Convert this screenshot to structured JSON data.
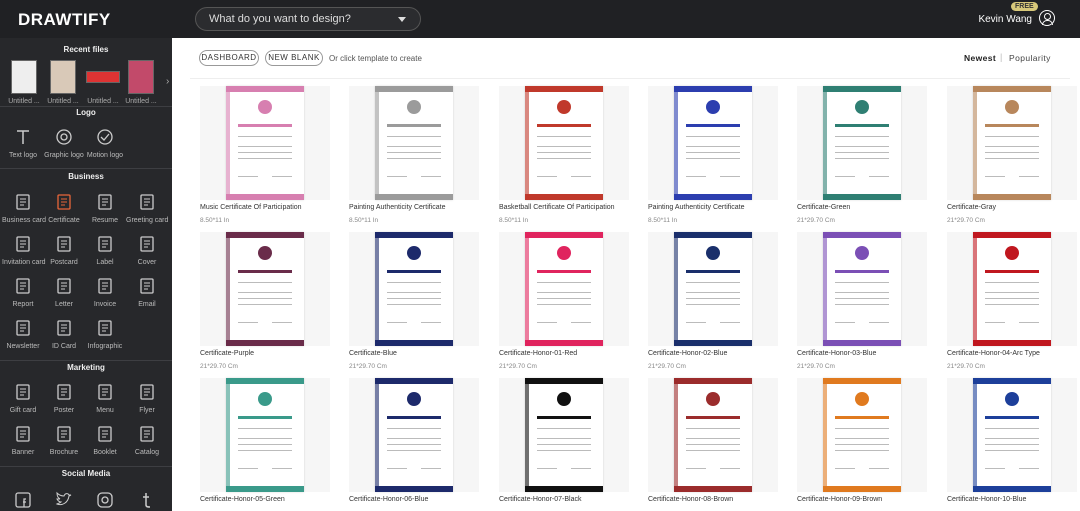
{
  "header": {
    "logo": "DRAWTIFY",
    "search_placeholder": "What do you want to design?",
    "user_name": "Kevin Wang",
    "badge": "FREE"
  },
  "sidebar": {
    "recent_title": "Recent files",
    "recent": [
      "Untitled ...",
      "Untitled ...",
      "Untitled ...",
      "Untitled ..."
    ],
    "sections": [
      {
        "title": "Logo",
        "items": [
          "Text logo",
          "Graphic logo",
          "Motion logo"
        ]
      },
      {
        "title": "Business",
        "items": [
          "Business card",
          "Certificate",
          "Resume",
          "Greeting card",
          "Invitation card",
          "Postcard",
          "Label",
          "Cover",
          "Report",
          "Letter",
          "Invoice",
          "Email",
          "Newsletter",
          "ID Card",
          "Infographic"
        ]
      },
      {
        "title": "Marketing",
        "items": [
          "Gift card",
          "Poster",
          "Menu",
          "Flyer",
          "Banner",
          "Brochure",
          "Booklet",
          "Catalog"
        ]
      },
      {
        "title": "Social Media",
        "items": []
      }
    ]
  },
  "toolbar": {
    "dashboard": "DASHBOARD",
    "new_blank": "NEW BLANK",
    "hint": "Or click template to create",
    "sort_newest": "Newest",
    "sort_popularity": "Popularity"
  },
  "templates": [
    {
      "name": "Music Certificate Of Participation",
      "size": "8.50*11 In",
      "accent": "#d77fb0"
    },
    {
      "name": "Painting Authenticity Certificate",
      "size": "8.50*11 In",
      "accent": "#9b9b9b"
    },
    {
      "name": "Basketball Certificate Of Participation",
      "size": "8.50*11 In",
      "accent": "#c0392b"
    },
    {
      "name": "Painting Authenticity Certificate",
      "size": "8.50*11 In",
      "accent": "#2c3eaf"
    },
    {
      "name": "Certificate-Green",
      "size": "21*29.70 Cm",
      "accent": "#2f7f73"
    },
    {
      "name": "Certificate-Gray",
      "size": "21*29.70 Cm",
      "accent": "#b8875c"
    },
    {
      "name": "Certificate-Purple",
      "size": "21*29.70 Cm",
      "accent": "#6a2c4a"
    },
    {
      "name": "Certificate-Blue",
      "size": "21*29.70 Cm",
      "accent": "#1d2a6b"
    },
    {
      "name": "Certificate-Honor-01-Red",
      "size": "21*29.70 Cm",
      "accent": "#e0245e"
    },
    {
      "name": "Certificate-Honor-02-Blue",
      "size": "21*29.70 Cm",
      "accent": "#1a2f6b"
    },
    {
      "name": "Certificate-Honor-03-Blue",
      "size": "21*29.70 Cm",
      "accent": "#7b4fb5"
    },
    {
      "name": "Certificate-Honor-04-Arc Type",
      "size": "21*29.70 Cm",
      "accent": "#c0171f"
    },
    {
      "name": "Certificate-Honor-05-Green",
      "size": "",
      "accent": "#3a9a8a"
    },
    {
      "name": "Certificate-Honor-06-Blue",
      "size": "",
      "accent": "#1d2a6b"
    },
    {
      "name": "Certificate-Honor-07-Black",
      "size": "",
      "accent": "#111111"
    },
    {
      "name": "Certificate-Honor-08-Brown",
      "size": "",
      "accent": "#9b2c2c"
    },
    {
      "name": "Certificate-Honor-09-Brown",
      "size": "",
      "accent": "#e07a1f"
    },
    {
      "name": "Certificate-Honor-10-Blue",
      "size": "",
      "accent": "#1d3f9a"
    }
  ]
}
